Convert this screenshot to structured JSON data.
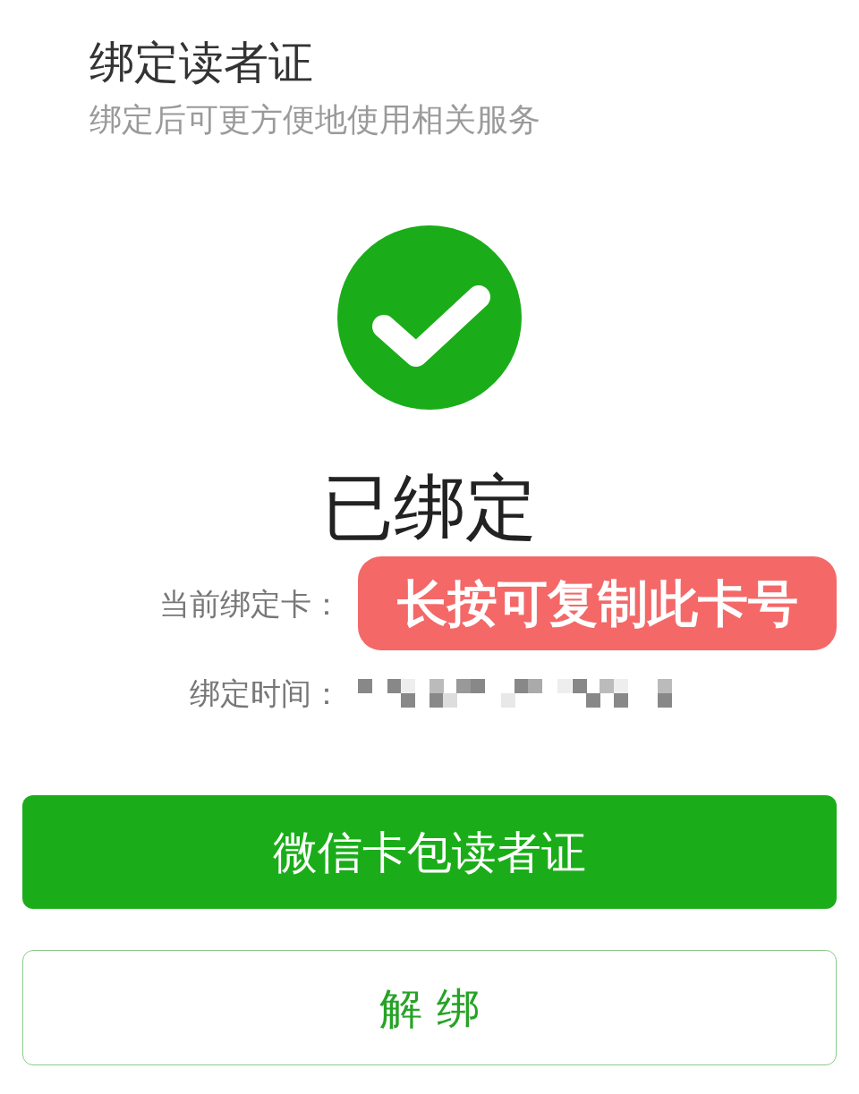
{
  "header": {
    "title": "绑定读者证",
    "subtitle": "绑定后可更方便地使用相关服务"
  },
  "status": {
    "kind": "bound",
    "text": "已绑定"
  },
  "details": [
    {
      "label": "当前绑定卡：",
      "overlay_note": "长按可复制此卡号",
      "redacted": false
    },
    {
      "label": "绑定时间：",
      "redacted": true
    }
  ],
  "buttons": [
    {
      "label": "微信卡包读者证",
      "kind": "primary"
    },
    {
      "label": "解 绑",
      "kind": "outline"
    }
  ]
}
